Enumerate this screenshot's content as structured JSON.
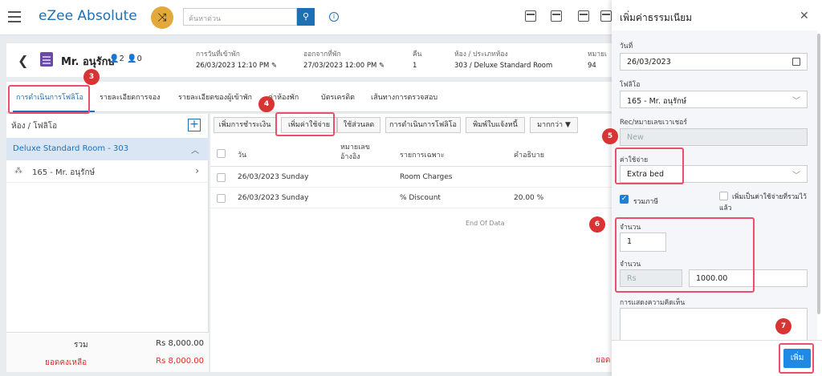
{
  "app": {
    "logo": "eZee Absolute"
  },
  "search": {
    "placeholder": "ค้นหาด่วน"
  },
  "guest": {
    "name": "Mr. อนุรักษ์",
    "counts": "👤2 👤0",
    "fields": [
      {
        "label": "การวันที่เข้าพัก",
        "value": "26/03/2023 12:10 PM ✎"
      },
      {
        "label": "ออกจากที่พัก",
        "value": "27/03/2023 12:00 PM ✎"
      },
      {
        "label": "คืน",
        "value": "1"
      },
      {
        "label": "ห้อง / ประเภทห้อง",
        "value": "303 / Deluxe Standard Room"
      },
      {
        "label": "หมายเ",
        "value": "94"
      }
    ]
  },
  "tabs": [
    "การดำเนินการโฟลิโอ",
    "รายละเอียดการจอง",
    "รายละเอียดของผู้เข้าพัก",
    "ค่าห้องพัก",
    "บัตรเครดิต",
    "เส้นทางการตรวจสอบ"
  ],
  "folio": {
    "header": "ห้อง / โฟลิโอ",
    "room": "Deluxe Standard Room - 303",
    "guest_item": "165 - Mr. อนุรักษ์",
    "total_label": "รวม",
    "total_value": "Rs 8,000.00",
    "balance_label": "ยอดคงเหลือ",
    "balance_value": "Rs 8,000.00"
  },
  "toolbar": [
    "เพิ่มการชำระเงิน",
    "เพิ่มค่าใช้จ่าย",
    "ใช้ส่วนลด",
    "การดำเนินการโฟลิโอ",
    "พิมพ์ใบแจ้งหนี้",
    "มากกว่า ▼"
  ],
  "grid": {
    "headers": [
      "วัน",
      "หมายเลข อ้างอิง",
      "รายการเฉพาะ",
      "คำอธิบาย"
    ],
    "rows": [
      {
        "day": "26/03/2023 Sunday",
        "ref": "",
        "item": "Room Charges",
        "desc": ""
      },
      {
        "day": "26/03/2023 Sunday",
        "ref": "",
        "item": "% Discount",
        "desc": "20.00 %"
      }
    ],
    "end_text": "End Of Data",
    "corner_text": "ยอด"
  },
  "drawer": {
    "title": "เพิ่มค่าธรรมเนียม",
    "date_label": "วันที่",
    "date_value": "26/03/2023",
    "folio_label": "โฟลิโอ",
    "folio_value": "165 - Mr. อนุรักษ์",
    "voucher_label": "Rec/หมายเลขเวาเชอร์",
    "voucher_placeholder": "New",
    "expense_label": "ค่าใช้จ่าย",
    "expense_value": "Extra bed",
    "include_tax_label": "รวมภาษี",
    "include_tax_checked": true,
    "add_expense_label": "เพิ่มเป็นค่าใช้จ่ายที่รวมไว้แล้ว",
    "qty_label": "จำนวน",
    "qty_value": "1",
    "amount_label": "จำนวน",
    "currency": "Rs",
    "amount_value": "1000.00",
    "comment_label": "การแสดงความคิดเห็น",
    "add_button": "เพิ่ม"
  },
  "annotations": [
    "3",
    "4",
    "5",
    "6",
    "7"
  ],
  "colors": {
    "accent": "#1f6fb5",
    "highlight": "#e8506b",
    "badge": "#d93434",
    "primary_button": "#1f8ae6"
  }
}
